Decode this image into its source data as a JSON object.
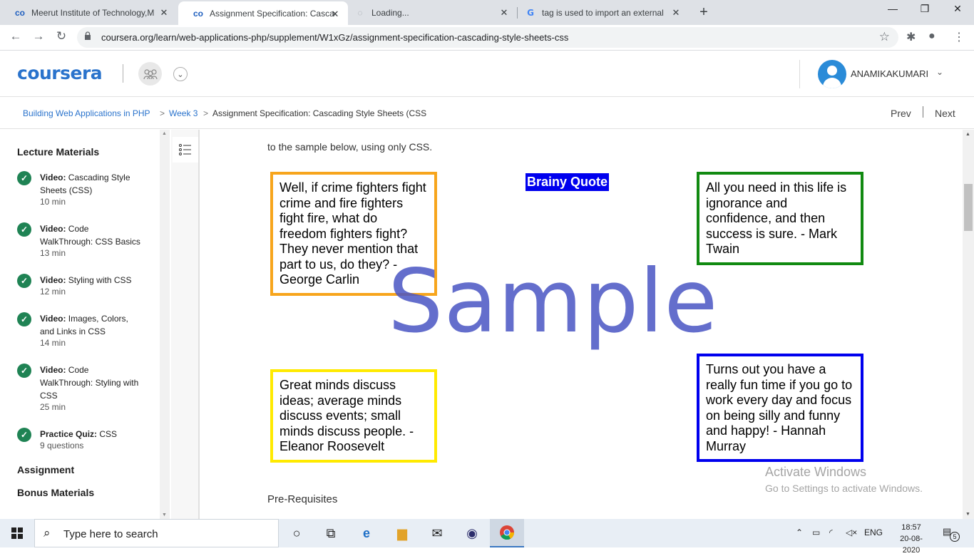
{
  "browser": {
    "tabs": [
      {
        "title": "Meerut Institute of Technology,M",
        "favicon": "coursera-icon",
        "active": false
      },
      {
        "title": "Assignment Specification: Cascac",
        "favicon": "coursera-icon",
        "active": true
      },
      {
        "title": "Loading...",
        "favicon": "loading-spinner-icon",
        "active": false
      },
      {
        "title": "tag is used to import an external",
        "favicon": "google-icon",
        "active": false
      }
    ],
    "new_tab": "+",
    "address": "coursera.org/learn/web-applications-php/supplement/W1xGz/assignment-specification-cascading-style-sheets-css"
  },
  "header": {
    "logo": "coursera",
    "username": "ANAMIKAKUMARI"
  },
  "breadcrumb": {
    "course": "Building Web Applications in PHP",
    "week": "Week 3",
    "current": "Assignment Specification: Cascading Style Sheets (CSS",
    "sep": ">",
    "prev": "Prev",
    "next": "Next"
  },
  "sidebar": {
    "section_lecture": "Lecture Materials",
    "items": [
      {
        "type": "Video:",
        "title": "Cascading Style Sheets (CSS)",
        "duration": "10 min"
      },
      {
        "type": "Video:",
        "title": "Code WalkThrough: CSS Basics",
        "duration": "13 min"
      },
      {
        "type": "Video:",
        "title": "Styling with CSS",
        "duration": "12 min"
      },
      {
        "type": "Video:",
        "title": "Images, Colors, and Links in CSS",
        "duration": "14 min"
      },
      {
        "type": "Video:",
        "title": "Code WalkThrough: Styling with CSS",
        "duration": "25 min"
      },
      {
        "type": "Practice Quiz:",
        "title": "CSS",
        "duration": "9 questions"
      }
    ],
    "section_assignment": "Assignment",
    "section_bonus": "Bonus Materials"
  },
  "content": {
    "intro": "to the sample below, using only CSS.",
    "sample": {
      "title": "Brainy Quote",
      "watermark": "Sample",
      "quotes": [
        {
          "text": "Well, if crime fighters fight crime and fire fighters fight fire, what do freedom fighters fight? They never mention that part to us, do they? - George Carlin",
          "border": "#f7a51c"
        },
        {
          "text": "All you need in this life is ignorance and confidence, and then success is sure. - Mark Twain",
          "border": "#118a11"
        },
        {
          "text": "Great minds discuss ideas; average minds discuss events; small minds discuss people. - Eleanor Roosevelt",
          "border": "#ffea00"
        },
        {
          "text": "Turns out you have a really fun time if you go to work every day and focus on being silly and funny and happy! - Hannah Murray",
          "border": "#0000ee"
        }
      ]
    },
    "prereq_heading": "Pre-Requisites",
    "activate_title": "Activate Windows",
    "activate_sub": "Go to Settings to activate Windows."
  },
  "taskbar": {
    "search_placeholder": "Type here to search",
    "lang": "ENG",
    "time": "18:57",
    "date": "20-08-2020",
    "notifications": "5"
  },
  "colors": {
    "brand": "#2a73cc",
    "check": "#1f8354"
  }
}
